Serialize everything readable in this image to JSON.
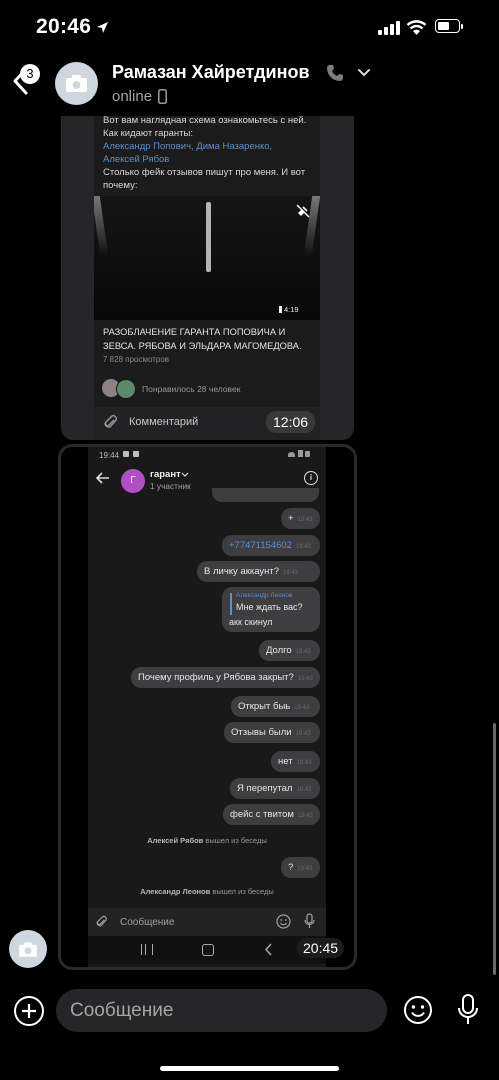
{
  "status_bar": {
    "time": "20:46"
  },
  "header": {
    "back_badge": "3",
    "contact_name": "Рамазан Хайретдинов",
    "status": "online"
  },
  "post": {
    "text_line1": "Вот вам наглядная схема ознакомьтесь с ней.",
    "text_line2": "Как кидают гаранты:",
    "link_line1": "Александр Попович, Дима Назаренко,",
    "link_line2": "Алексей Рябов",
    "text_line3": "Столько фейк отзывов пишут про меня. И вот",
    "text_line4": "почему:",
    "video_duration": "4:19",
    "video_title_line1": "РАЗОБЛАЧЕНИЕ ГАРАНТА ПОПОВИЧА И",
    "video_title_line2": "ЗЕВСА. РЯБОВА И ЭЛЬДАРА МАГОМЕДОВА.",
    "views": "7 828 просмотров",
    "likes": "Понравилось 28 человек",
    "comment": "Комментарий",
    "time": "12:06"
  },
  "screenshot": {
    "phone_time": "19:44",
    "chat_title": "гарант",
    "chat_avatar_letter": "Г",
    "participants": "1 участник",
    "messages": {
      "m1": "+",
      "m2": "+77471154602",
      "m3": "В личку аккаунт?",
      "reply_author": "Александр Леонов",
      "reply_quote": "Мне ждать вас?",
      "reply_text": "акк скинул",
      "m4": "Долго",
      "m5": "Почему профиль у Рябова закрыт?",
      "m6": "Открыт быь",
      "m7": "Отзывы были",
      "m8": "нет",
      "m9": "Я перепутал",
      "m10": "фейс с твитом",
      "m11": "?"
    },
    "sys1_name": "Алексей Рябов",
    "sys1_text": "вышел из беседы",
    "sys2_name": "Александр Леонов",
    "sys2_text": "вышел из беседы",
    "input_placeholder": "Сообщение",
    "time": "20:45"
  },
  "composer": {
    "placeholder": "Сообщение"
  },
  "colors": {
    "accent_link": "#5f8ec9",
    "avatar_purple": "#b24fc7",
    "bubble": "#3e3e40"
  }
}
